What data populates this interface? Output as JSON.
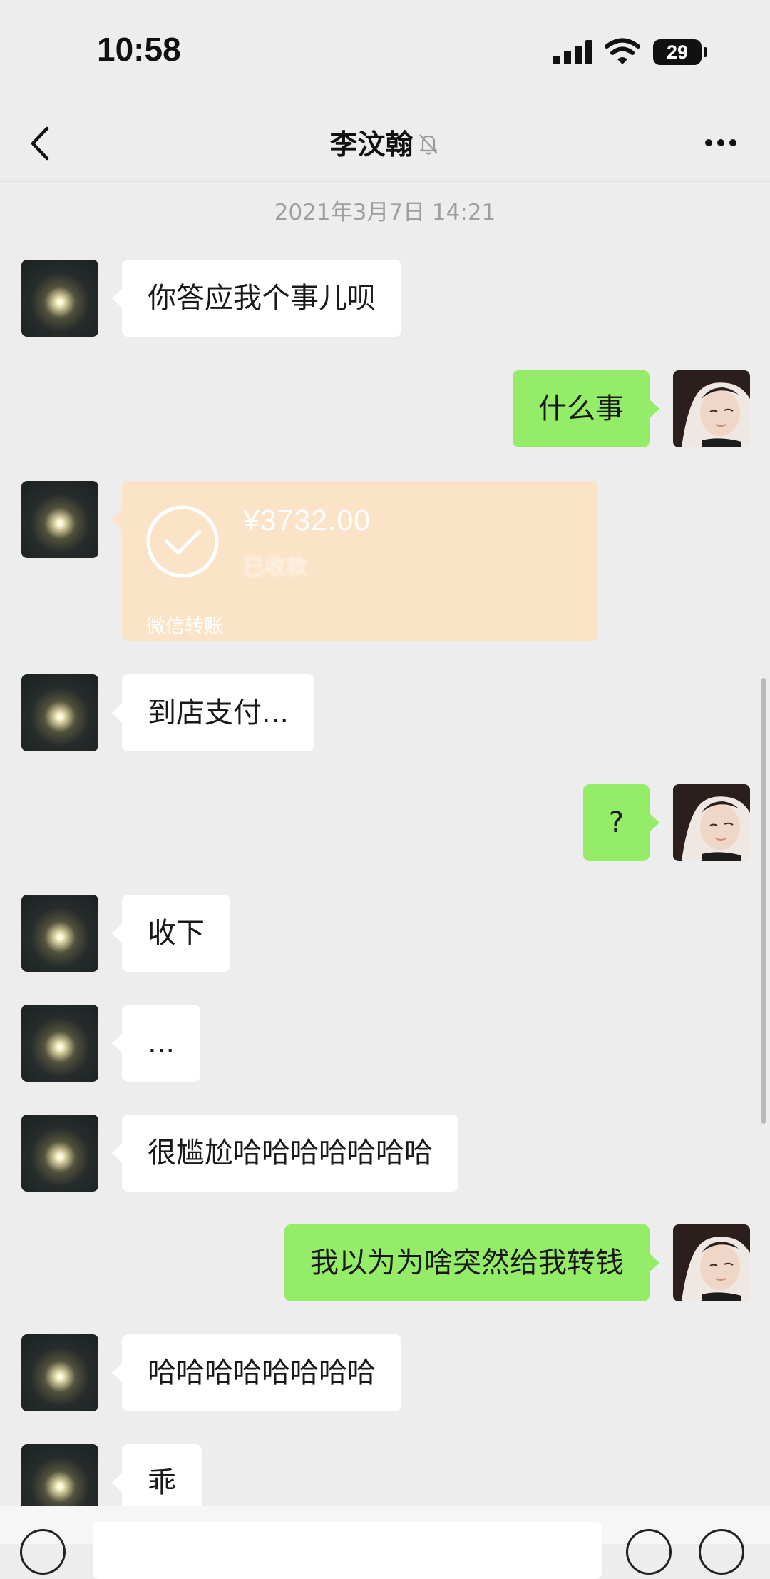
{
  "status_bar": {
    "time": "10:58",
    "battery": "29",
    "icons": [
      "cellular-signal-icon",
      "wifi-icon",
      "battery-icon"
    ]
  },
  "nav": {
    "title": "李汶翰",
    "icons": [
      "back-arrow-icon",
      "mute-bell-icon",
      "more-dots-icon"
    ]
  },
  "chat": {
    "timestamp": "2021年3月7日 14:21",
    "messages": [
      {
        "side": "left",
        "type": "text",
        "text": "你答应我个事儿呗"
      },
      {
        "side": "right",
        "type": "text",
        "text": "什么事"
      },
      {
        "side": "left",
        "type": "transfer",
        "amount": "¥3732.00",
        "status": "已收款",
        "source": "微信转账"
      },
      {
        "side": "left",
        "type": "text",
        "text": "到店支付..."
      },
      {
        "side": "right",
        "type": "text",
        "text": "?"
      },
      {
        "side": "left",
        "type": "text",
        "text": "收下"
      },
      {
        "side": "left",
        "type": "text",
        "text": "..."
      },
      {
        "side": "left",
        "type": "text",
        "text": "很尴尬哈哈哈哈哈哈哈"
      },
      {
        "side": "right",
        "type": "text",
        "text": "我以为为啥突然给我转钱"
      },
      {
        "side": "left",
        "type": "text",
        "text": "哈哈哈哈哈哈哈哈"
      },
      {
        "side": "left",
        "type": "text",
        "text": "乖"
      }
    ]
  },
  "colors": {
    "background": "#ededed",
    "sent_bubble": "#95ec69",
    "received_bubble": "#ffffff",
    "transfer_card": "#fbe3c7"
  }
}
